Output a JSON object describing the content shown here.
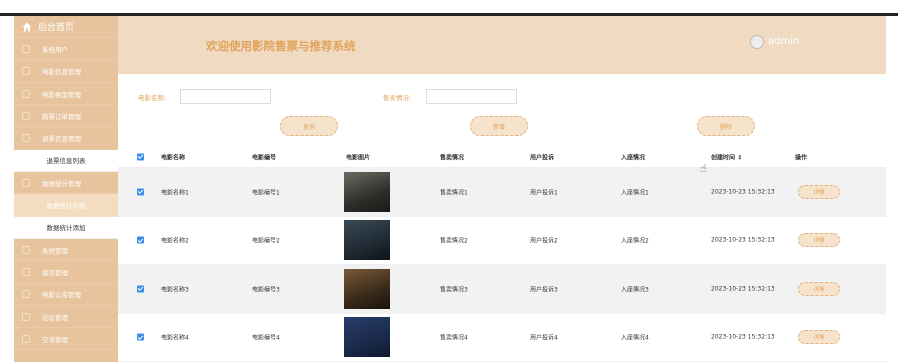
{
  "sidebar": {
    "home_label": "后台首页",
    "items": [
      {
        "label": "系统用户",
        "type": "item"
      },
      {
        "label": "电影信息管理",
        "type": "item"
      },
      {
        "label": "电影类型管理",
        "type": "item"
      },
      {
        "label": "购票订单管理",
        "type": "item"
      },
      {
        "label": "退票信息管理",
        "type": "item"
      },
      {
        "label": "退票信息列表",
        "type": "sub"
      },
      {
        "label": "数据统计管理",
        "type": "item"
      },
      {
        "label": "数据统计列表",
        "type": "active"
      },
      {
        "label": "数据统计添加",
        "type": "sub"
      },
      {
        "label": "系统管理",
        "type": "item"
      },
      {
        "label": "留言管理",
        "type": "item"
      },
      {
        "label": "电影公告管理",
        "type": "item"
      },
      {
        "label": "论坛管理",
        "type": "item"
      },
      {
        "label": "交流管理",
        "type": "item"
      }
    ]
  },
  "header": {
    "title": "欢迎使用影院售票与推荐系统",
    "user": "admin"
  },
  "search": {
    "movie_name_label": "电影名称:",
    "sales_label": "售卖情况:",
    "query_button": "查询",
    "add_button": "新增",
    "delete_button": "删除"
  },
  "table": {
    "headers": {
      "name": "电影名称",
      "code": "电影编号",
      "image": "电影图片",
      "sales": "售卖情况",
      "complaint": "用户投诉",
      "attendance": "入座情况",
      "created": "创建时间 ⇕",
      "action": "操作"
    },
    "rows": [
      {
        "name": "电影名称1",
        "code": "电影编号1",
        "sales": "售卖情况1",
        "complaint": "用户投诉1",
        "attendance": "入座情况1",
        "created": "2023-10-23 15:32:13",
        "action": "详情"
      },
      {
        "name": "电影名称2",
        "code": "电影编号2",
        "sales": "售卖情况2",
        "complaint": "用户投诉2",
        "attendance": "入座情况2",
        "created": "2023-10-23 15:32:13",
        "action": "详情"
      },
      {
        "name": "电影名称3",
        "code": "电影编号3",
        "sales": "售卖情况3",
        "complaint": "用户投诉3",
        "attendance": "入座情况3",
        "created": "2023-10-23 15:32:13",
        "action": "详情"
      },
      {
        "name": "电影名称4",
        "code": "电影编号4",
        "sales": "售卖情况4",
        "complaint": "用户投诉4",
        "attendance": "入座情况4",
        "created": "2023-10-23 15:32:13",
        "action": "详情"
      }
    ]
  }
}
